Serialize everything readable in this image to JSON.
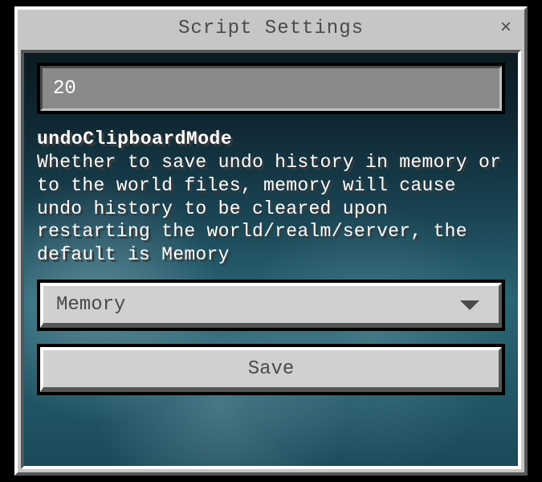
{
  "titlebar": {
    "title": "Script Settings"
  },
  "input": {
    "value": "20"
  },
  "setting": {
    "name": "undoClipboardMode",
    "description": "Whether to save undo history in memory or to the world files, memory will cause undo history to be cleared upon restarting the world/realm/server, the default is Memory"
  },
  "dropdown": {
    "selected": "Memory"
  },
  "buttons": {
    "save": "Save"
  }
}
